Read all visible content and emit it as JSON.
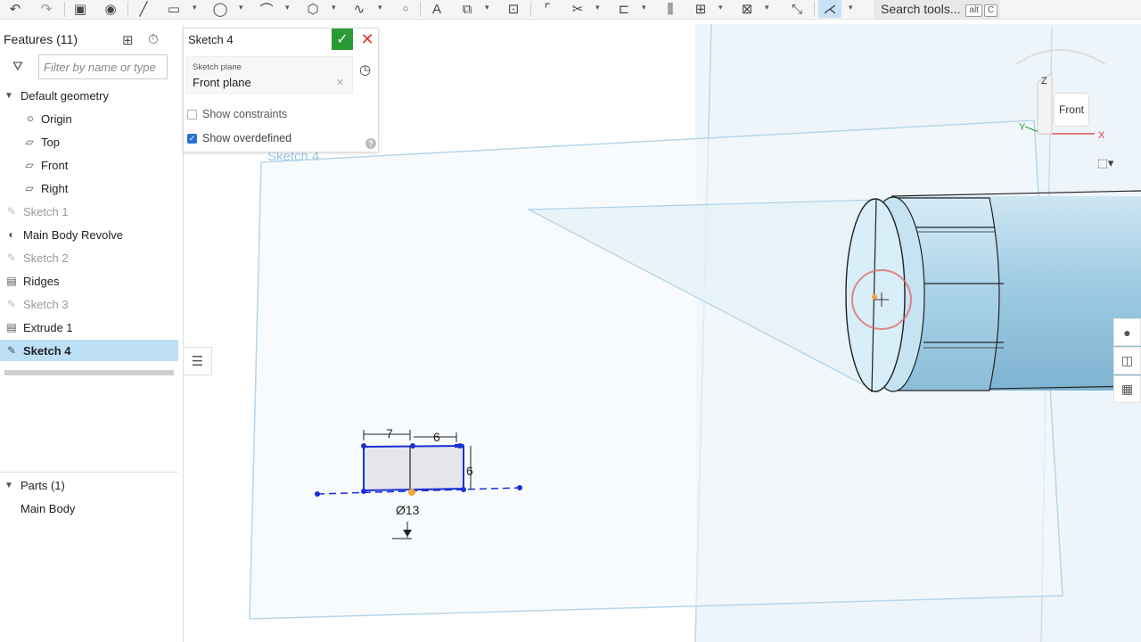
{
  "toolbar": {
    "icons": [
      "undo-icon",
      "redo-icon",
      "clipboard-icon",
      "use-icon",
      "line-icon",
      "rectangle-icon",
      "circle-icon",
      "arc-icon",
      "polygon-icon",
      "spline-icon",
      "point-icon",
      "text-icon",
      "construction-icon",
      "dimension-icon",
      "fillet-icon",
      "trim-icon",
      "offset-icon",
      "mirror-icon",
      "pattern-icon",
      "import-icon",
      "intersect-icon",
      "snap-icon"
    ],
    "search_label": "Search tools...",
    "shortcut_keys": [
      "alt",
      "C"
    ]
  },
  "feature_panel": {
    "header": "Features (11)",
    "filter_placeholder": "Filter by name or type",
    "tree": [
      {
        "label": "Default geometry",
        "type": "group"
      },
      {
        "label": "Origin",
        "type": "origin"
      },
      {
        "label": "Top",
        "type": "plane"
      },
      {
        "label": "Front",
        "type": "plane"
      },
      {
        "label": "Right",
        "type": "plane"
      },
      {
        "label": "Sketch 1",
        "type": "sketch-dim"
      },
      {
        "label": "Main Body Revolve",
        "type": "revolve"
      },
      {
        "label": "Sketch 2",
        "type": "sketch-dim"
      },
      {
        "label": "Ridges",
        "type": "extrude"
      },
      {
        "label": "Sketch 3",
        "type": "sketch-dim"
      },
      {
        "label": "Extrude 1",
        "type": "extrude"
      },
      {
        "label": "Sketch 4",
        "type": "sketch-selected"
      }
    ],
    "parts_header": "Parts (1)",
    "parts": [
      "Main Body"
    ]
  },
  "sketch_dialog": {
    "title": "Sketch 4",
    "plane_label": "Sketch plane",
    "plane_value": "Front plane",
    "show_constraints": "Show constraints",
    "show_constraints_checked": false,
    "show_overdefined": "Show overdefined",
    "show_overdefined_checked": true,
    "help": "?"
  },
  "viewport": {
    "sketch_name": "Sketch 4",
    "dims": {
      "d1": "7",
      "d2": "6",
      "d3": "6",
      "d4": "Ø13"
    },
    "view_cube": {
      "face": "Front",
      "axis_x": "X",
      "axis_y": "Y",
      "axis_z": "Z"
    }
  },
  "colors": {
    "accent": "#2a9a34",
    "selection": "#bde0f7",
    "sketch_line": "#1a2fd6",
    "body": "#a6cfe6"
  }
}
